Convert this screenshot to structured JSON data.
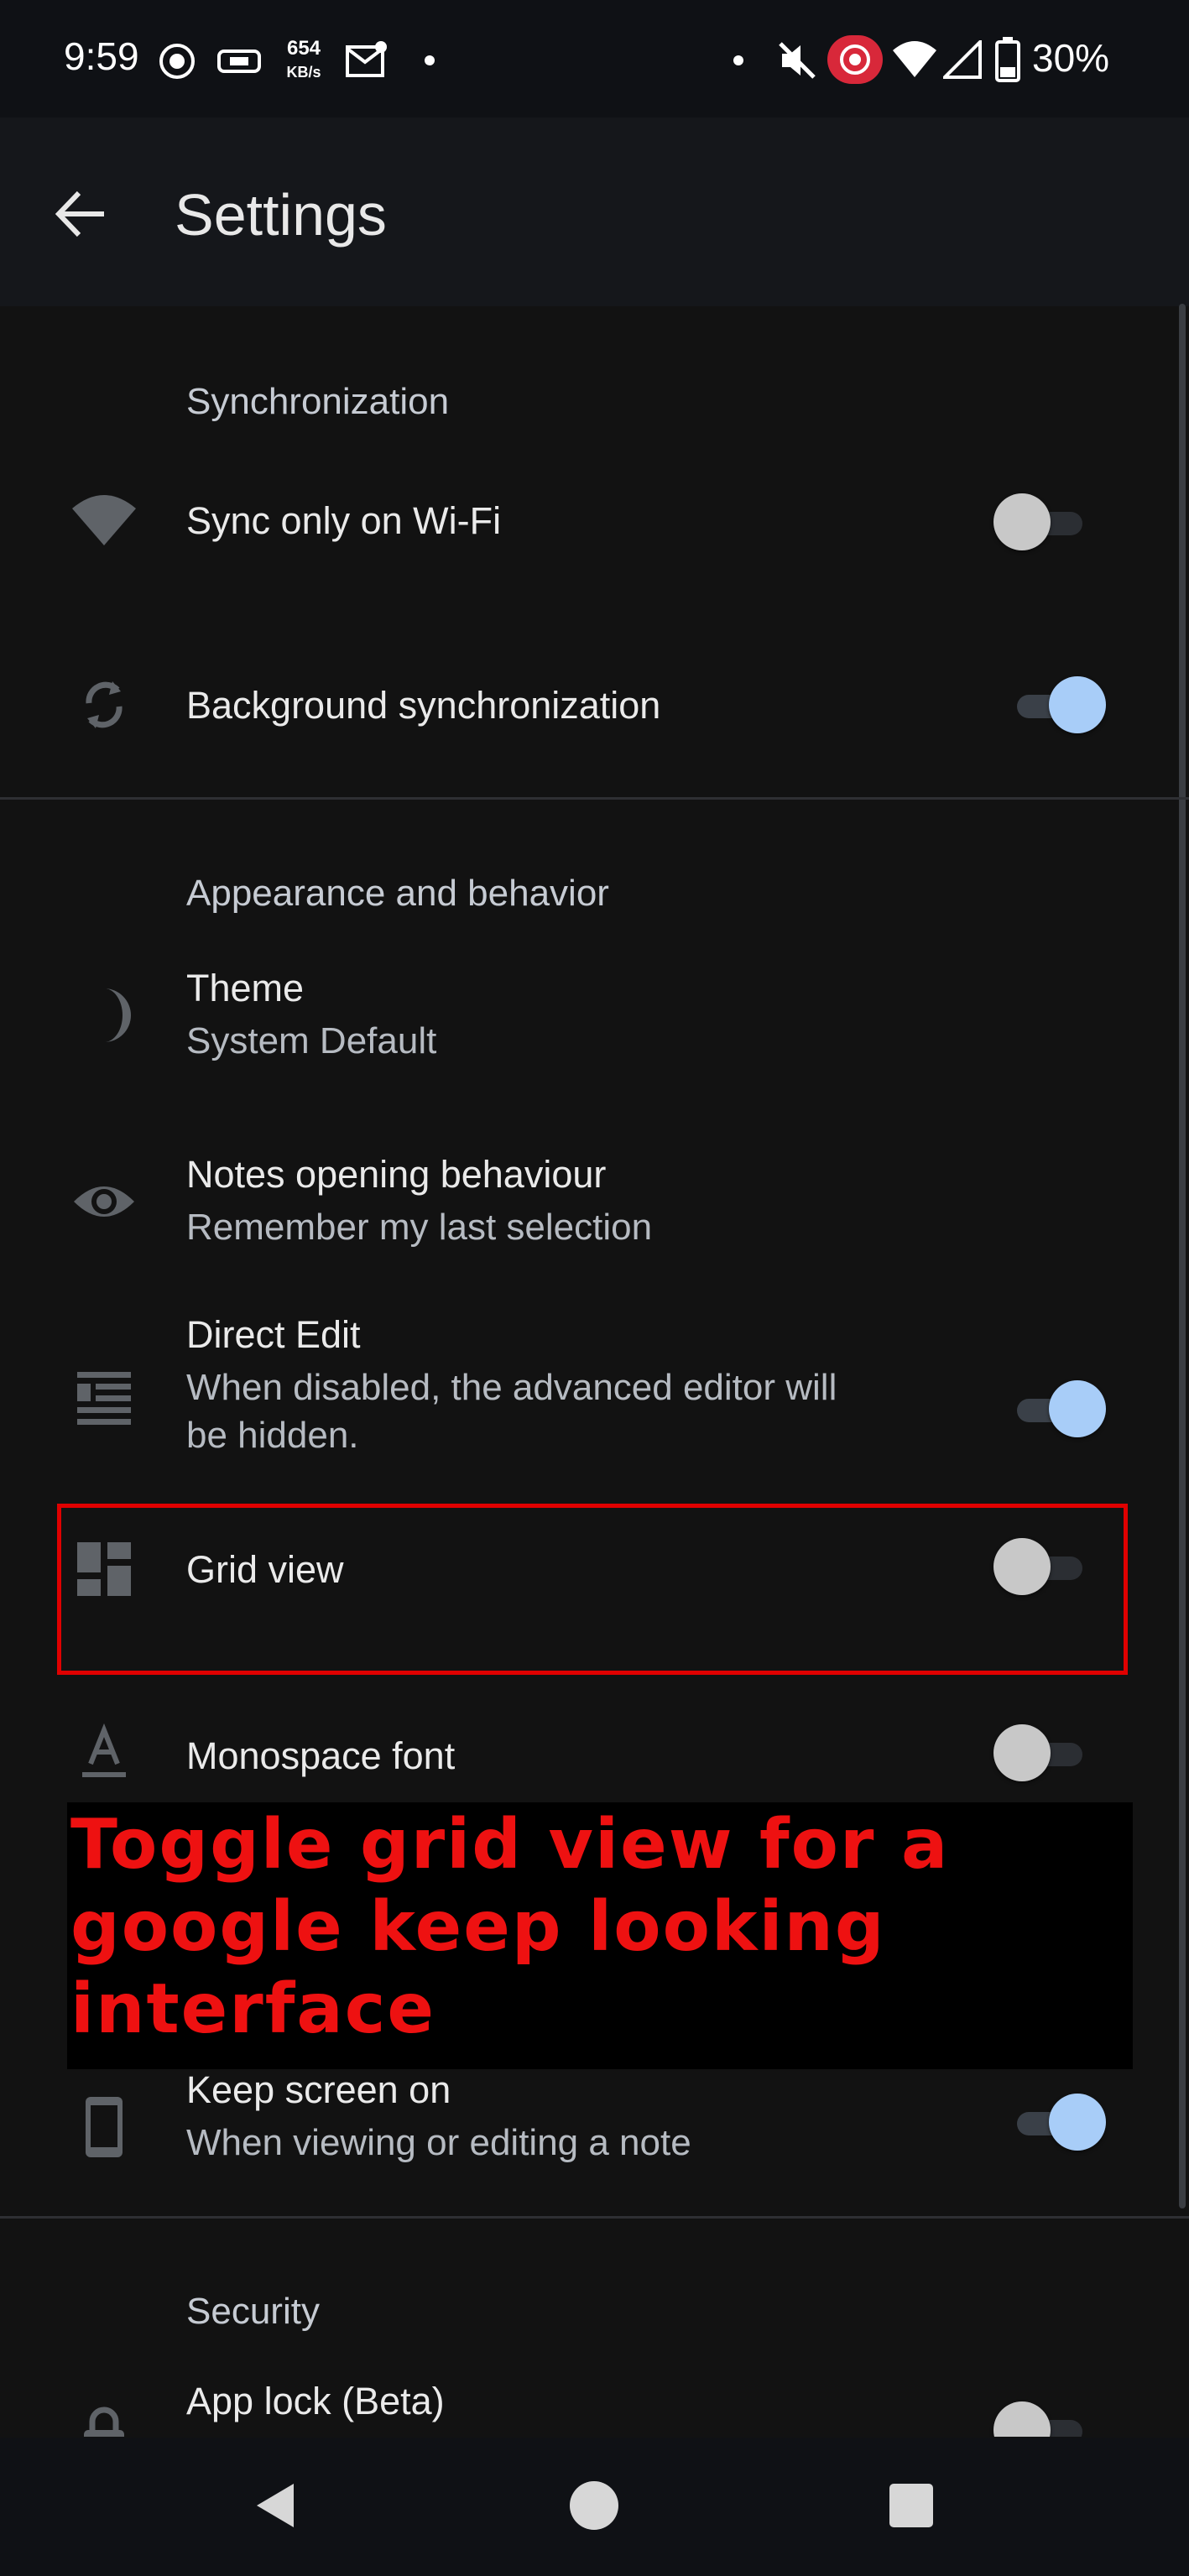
{
  "status_bar": {
    "time": "9:59",
    "net_speed_value": "654",
    "net_speed_unit": "KB/s",
    "battery": "30%",
    "icons": [
      "record-icon",
      "screen-cast-icon",
      "mail-icon",
      "notification-dot-icon",
      "notification-dot-icon",
      "mute-icon",
      "screen-record-icon",
      "wifi-icon",
      "signal-icon",
      "battery-icon"
    ]
  },
  "app_bar": {
    "back_icon": "arrow-back-icon",
    "title": "Settings"
  },
  "sections": {
    "sync": {
      "title": "Synchronization",
      "items": {
        "wifi": {
          "label": "Sync only on Wi-Fi",
          "icon": "wifi-icon",
          "on": false
        },
        "background": {
          "label": "Background synchronization",
          "icon": "sync-icon",
          "on": true
        }
      }
    },
    "appearance": {
      "title": "Appearance and behavior",
      "items": {
        "theme": {
          "label": "Theme",
          "value": "System Default",
          "icon": "moon-icon"
        },
        "notes_opening": {
          "label": "Notes opening behaviour",
          "value": "Remember my last selection",
          "icon": "eye-icon"
        },
        "direct_edit": {
          "label": "Direct Edit",
          "value_line1": "When disabled, the advanced editor will",
          "value_line2": "be hidden.",
          "icon": "text-lines-icon",
          "on": true
        },
        "grid_view": {
          "label": "Grid view",
          "icon": "grid-dashboard-icon",
          "on": false
        },
        "monospace": {
          "label": "Monospace font",
          "icon": "text-a-icon",
          "on": false
        },
        "keep_screen": {
          "label": "Keep screen on",
          "value": "When viewing or editing a note",
          "icon": "phone-icon",
          "on": true
        }
      }
    },
    "security": {
      "title": "Security",
      "items": {
        "app_lock": {
          "label": "App lock (Beta)",
          "icon": "lock-icon",
          "on": false
        }
      }
    }
  },
  "annotation": {
    "line1": "Toggle grid view for a",
    "line2": "google keep looking",
    "line3": "interface"
  },
  "nav_bar": {
    "buttons": [
      "back-triangle-icon",
      "home-circle-icon",
      "recents-square-icon"
    ]
  },
  "colors": {
    "background": "#121212",
    "switch_on_thumb": "#a8cdf8",
    "switch_off_thumb": "#c8c8c8",
    "highlight": "#e00000",
    "annotation_text": "#ee1111"
  }
}
